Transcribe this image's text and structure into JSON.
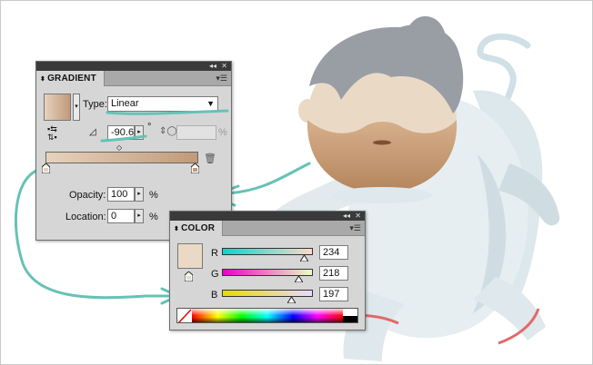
{
  "gradient_panel": {
    "tab_label": "GRADIENT",
    "type_label": "Type:",
    "type_value": "Linear",
    "angle_value": "-90.6",
    "degree_symbol": "°",
    "aspect_unit": "%",
    "opacity_label": "Opacity:",
    "opacity_value": "100",
    "opacity_unit": "%",
    "location_label": "Location:",
    "location_value": "0",
    "location_unit": "%",
    "gradient_start_color": "#e6d2bd",
    "gradient_end_color": "#c09a79"
  },
  "color_panel": {
    "tab_label": "COLOR",
    "r_label": "R",
    "r_value": "234",
    "g_label": "G",
    "g_value": "218",
    "b_label": "B",
    "b_value": "197",
    "current_color": "#eadac5"
  },
  "colors": {
    "annotation": "#66c2b5",
    "panel_bg": "#d6d6d6"
  }
}
